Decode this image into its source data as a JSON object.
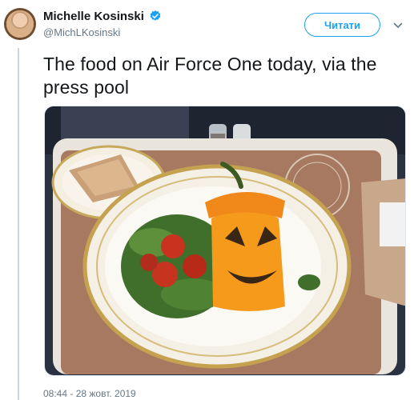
{
  "tweet": {
    "author": {
      "display_name": "Michelle Kosinski",
      "handle": "@MichLKosinski",
      "verified": true
    },
    "follow_button_label": "Читати",
    "text": "The food on Air Force One today, via the press pool",
    "timestamp": "08:44 - 28 жовт. 2019",
    "media_icon": "photo-food-tray",
    "colors": {
      "accent": "#1da1f2",
      "text": "#14171a",
      "secondary_text": "#657786"
    }
  }
}
